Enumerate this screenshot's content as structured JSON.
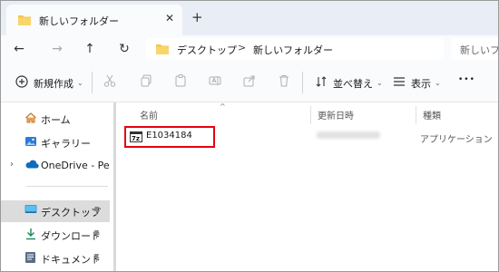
{
  "window": {
    "tab_title": "新しいフォルダー",
    "tab_close_glyph": "✕",
    "new_tab_glyph": "+"
  },
  "nav": {
    "back": "←",
    "forward": "→",
    "up": "↑",
    "refresh": "↻"
  },
  "address": {
    "crumbs": [
      "デスクトップ",
      "新しいフォルダー"
    ],
    "separator": ">",
    "search_placeholder": "新しいフォルダー"
  },
  "toolbar": {
    "new_label": "新規作成",
    "sort_label": "並べ替え",
    "view_label": "表示",
    "more_glyph": "•••"
  },
  "sidebar": {
    "items": [
      {
        "label": "ホーム",
        "icon": "home-icon"
      },
      {
        "label": "ギャラリー",
        "icon": "gallery-icon"
      },
      {
        "label": "OneDrive - Perso",
        "icon": "onedrive-icon"
      },
      {
        "label": "デスクトップ",
        "icon": "desktop-icon",
        "selected": true,
        "pinned": true
      },
      {
        "label": "ダウンロード",
        "icon": "download-icon",
        "pinned": true
      },
      {
        "label": "ドキュメント",
        "icon": "documents-icon",
        "pinned": true
      }
    ],
    "expand_glyph": "›",
    "pin_glyph": "📌"
  },
  "columns": {
    "name": "名前",
    "modified": "更新日時",
    "type": "種類"
  },
  "files": [
    {
      "name": "E1034184",
      "type": "アプリケーション",
      "icon": "archive-exe-icon"
    }
  ],
  "colors": {
    "highlight_border": "#e60012",
    "folder": "#f4c64a",
    "onedrive": "#0f6cbd",
    "accent": "#0f6cbd"
  }
}
